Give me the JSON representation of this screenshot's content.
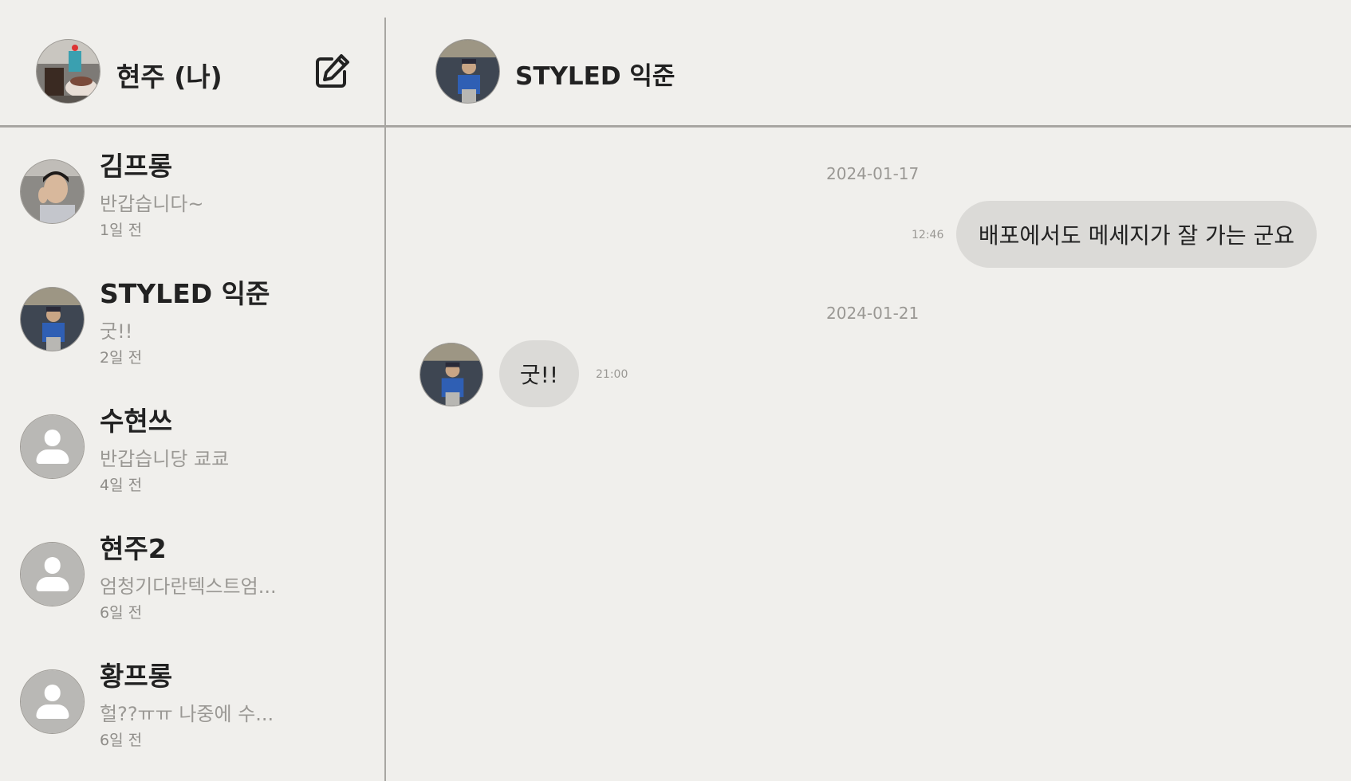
{
  "me": {
    "name": "현주 (나)",
    "avatar": "dessert-photo"
  },
  "compose_icon": "edit-icon",
  "conversations": [
    {
      "name": "김프롱",
      "preview": "반갑습니다~",
      "time": "1일 전",
      "avatar": "man-photo"
    },
    {
      "name": "STYLED 익준",
      "preview": "굿!!",
      "time": "2일 전",
      "avatar": "man-cap-photo"
    },
    {
      "name": "수현쓰",
      "preview": "반갑습니당 쿄쿄",
      "time": "4일 전",
      "avatar": "default-user-icon"
    },
    {
      "name": "현주2",
      "preview": "엄청기다란텍스트엄...",
      "time": "6일 전",
      "avatar": "default-user-icon"
    },
    {
      "name": "황프롱",
      "preview": "헐??ㅠㅠ 나중에 수...",
      "time": "6일 전",
      "avatar": "default-user-icon"
    }
  ],
  "chat": {
    "title": "STYLED 익준",
    "messages": [
      {
        "date": "2024-01-17",
        "text": "배포에서도 메세지가 잘 가는 군요",
        "time": "12:46",
        "direction": "outgoing"
      },
      {
        "date": "2024-01-21",
        "text": "굿!!",
        "time": "21:00",
        "direction": "incoming"
      }
    ]
  },
  "colors": {
    "background": "#f0efec",
    "divider": "#a8a6a2",
    "bubble": "#dbdad7",
    "muted_text": "#9a9894"
  }
}
